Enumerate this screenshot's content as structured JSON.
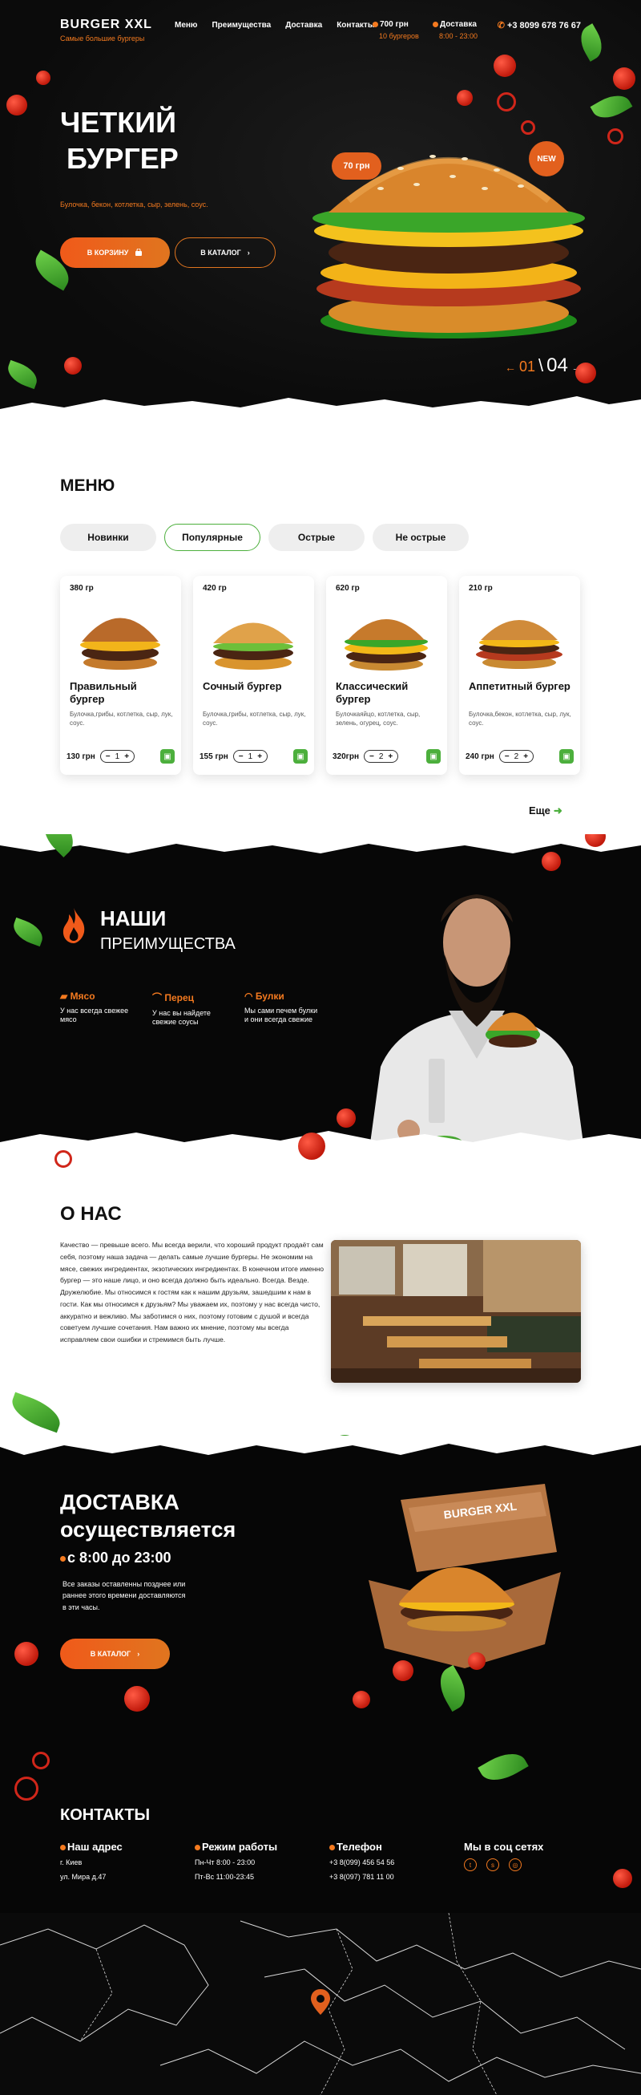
{
  "nav": {
    "logo_title": "BURGER  XXL",
    "logo_subtitle": "Самые большие бургеры",
    "links": [
      "Меню",
      "Преимущества",
      "Доставка",
      "Контакты"
    ],
    "cart_total": "700 грн",
    "cart_count": "10 бургеров",
    "delivery_label": "Доставка",
    "delivery_hours": "8:00 - 23:00",
    "phone": "+3 8099 678 76 67"
  },
  "hero": {
    "title_line1": "ЧЕТКИЙ",
    "title_line2": "БУРГЕР",
    "description": "Булочка, бекон, котлетка, сыр, зелень, соус.",
    "btn_cart": "В корзину",
    "btn_catalog": "В каталог",
    "price_badge": "70 грн",
    "new_badge": "NEW",
    "slide_current": "01",
    "slide_total": "04"
  },
  "menu": {
    "title": "МЕНЮ",
    "tabs": [
      "Новинки",
      "Популярные",
      "Острые",
      "Не острые"
    ],
    "active_tab": "Популярные",
    "items": [
      {
        "weight": "380 гр",
        "name": "Правильный бургер",
        "composition": "Булочка,грибы, котлетка, сыр, лук, соус.",
        "price": "130 грн",
        "qty": "1"
      },
      {
        "weight": "420 гр",
        "name": "Сочный бургер",
        "composition": "Булочка,грибы, котлетка, сыр, лук, соус.",
        "price": "155 грн",
        "qty": "1"
      },
      {
        "weight": "620 гр",
        "name": "Классический бургер",
        "composition": "Булочкаяйцо, котлетка, сыр, зелень, огурец, соус.",
        "price": "320грн",
        "qty": "2"
      },
      {
        "weight": "210 гр",
        "name": "Аппетитный бургер",
        "composition": "Булочка,бекон, котлетка, сыр, лук, соус.",
        "price": "240 грн",
        "qty": "2"
      }
    ],
    "more": "Еще"
  },
  "advantages": {
    "title_line1": "НАШИ",
    "title_line2": "ПРЕИМУЩЕСТВА",
    "items": [
      {
        "title": "Мясо",
        "text": "У нас всегда свежее мясо"
      },
      {
        "title": "Перец",
        "text": "У нас вы найдете свежие соусы"
      },
      {
        "title": "Булки",
        "text": "Мы сами печем булки и они всегда свежие"
      }
    ]
  },
  "about": {
    "title": "О НАС",
    "paragraph1": "Качество — превыше всего. Мы всегда верили, что хороший продукт продаёт сам себя, поэтому наша задача — делать самые лучшие бургеры. Не экономим на мясе, свежих ингредиентах, экзотических ингредиентах. В конечном итоге именно бургер — это наше лицо, и оно всегда должно быть идеально. Всегда. Везде.",
    "paragraph2": "Дружелюбие. Мы относимся к гостям как к нашим друзьям, зашедшим к нам в гости. Как мы относимся к друзьям? Мы уважаем их, поэтому у нас всегда чисто, аккуратно и вежливо. Мы заботимся о них, поэтому готовим с душой и всегда советуем лучшие сочетания. Нам важно их мнение, поэтому мы всегда исправляем свои ошибки и стремимся быть лучше."
  },
  "delivery": {
    "title_line1": "ДОСТАВКА",
    "title_line2": "осуществляется",
    "hours": "с 8:00  до 23:00",
    "note": "Все заказы оставленны позднее или раннее этого времени доставляются в эти часы.",
    "btn_catalog": "В Каталог",
    "box_label": "BURGER  XXL"
  },
  "contacts": {
    "title": "КОНТАКТЫ",
    "address_title": "Наш адрес",
    "address_city": "г. Киев",
    "address_street": "ул. Мира д.47",
    "hours_title": "Режим работы",
    "hours_weekdays": "Пн-Чт 8:00 - 23:00",
    "hours_weekend": "Пт-Вс  11:00-23:45",
    "phone_title": "Телефон",
    "phone1": "+3 8(099) 456 54 56",
    "phone2": "+3 8(097) 781 11 00",
    "social_title": "Мы в соц сетях"
  }
}
